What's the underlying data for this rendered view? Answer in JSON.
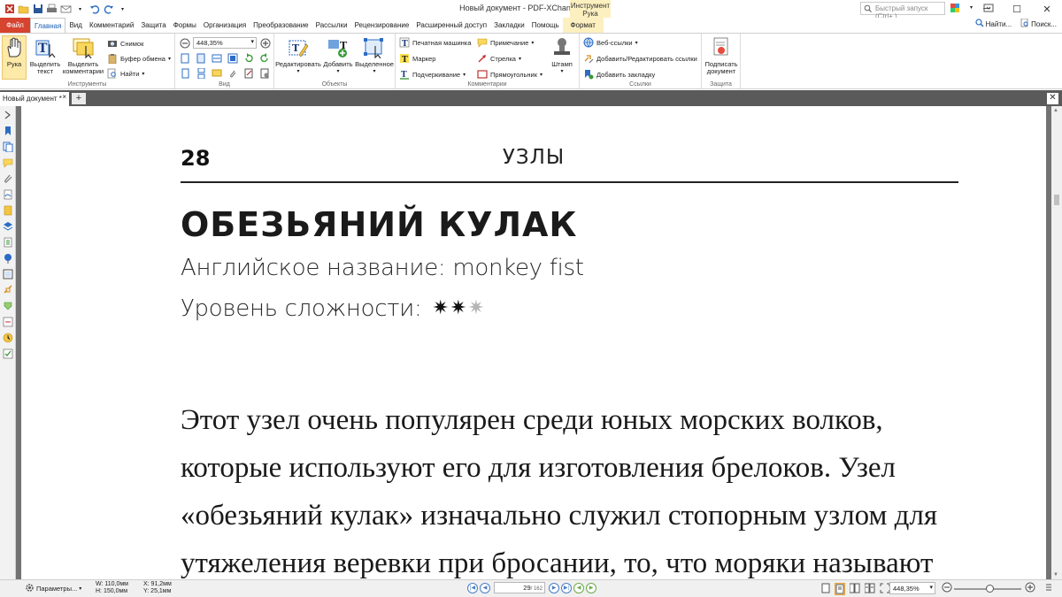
{
  "window": {
    "title": "Новый документ - PDF-XChange Editor",
    "context_group": "Инструмент Рука",
    "quick_launch_placeholder": "Быстрый запуск (Ctrl+.)",
    "find_label": "Найти...",
    "search_label": "Поиск..."
  },
  "tabs": [
    {
      "label": "Файл"
    },
    {
      "label": "Главная"
    },
    {
      "label": "Вид"
    },
    {
      "label": "Комментарий"
    },
    {
      "label": "Защита"
    },
    {
      "label": "Формы"
    },
    {
      "label": "Организация"
    },
    {
      "label": "Преобразование"
    },
    {
      "label": "Рассылки"
    },
    {
      "label": "Рецензирование"
    },
    {
      "label": "Расширенный доступ"
    },
    {
      "label": "Закладки"
    },
    {
      "label": "Помощь"
    },
    {
      "label": "Формат"
    }
  ],
  "ribbon": {
    "tools": {
      "group_label": "Инструменты",
      "hand": "Рука",
      "select_text": "Выделить текст",
      "select_comments": "Выделить комментарии",
      "snapshot": "Снимок",
      "clipboard": "Буфер обмена",
      "find": "Найти"
    },
    "view": {
      "group_label": "Вид",
      "zoom": "448,35%"
    },
    "objects": {
      "group_label": "Объекты",
      "edit": "Редактировать",
      "add": "Добавить",
      "selected": "Выделенное"
    },
    "comments": {
      "group_label": "Комментарии",
      "typewriter": "Печатная машинка",
      "marker": "Маркер",
      "underline": "Подчеркивание",
      "note": "Примечание",
      "arrow": "Стрелка",
      "rectangle": "Прямоугольник",
      "stamp": "Штамп"
    },
    "links": {
      "group_label": "Ссылки",
      "web_links": "Веб-ссылки",
      "add_edit_links": "Добавить/Редактировать ссылки",
      "add_bookmark": "Добавить закладку"
    },
    "protect": {
      "group_label": "Защита",
      "sign": "Подписать документ"
    }
  },
  "doc_tab": {
    "label": "Новый документ *"
  },
  "page": {
    "number": "28",
    "header": "УЗЛЫ",
    "knot_title": "ОБЕЗЬЯНИЙ КУЛАК",
    "english_name": "Английское название: monkey fist",
    "level_label": "Уровень сложности:",
    "difficulty": {
      "filled": 2,
      "total": 3
    },
    "body_lines": [
      "Этот узел очень популярен среди юных морских волков,",
      "которые используют его для изготовления брелоков. Узел",
      "«обезьяний кулак» изначально служил стопорным узлом для",
      "утяжеления веревки при бросании, то, что моряки называют"
    ]
  },
  "status": {
    "params": "Параметры...",
    "w": "W: 110,0мм",
    "h": "H: 150,0мм",
    "x": "X:   91,2мм",
    "y": "Y:   25,1мм",
    "current_page": "29",
    "total_pages": "/ 162",
    "zoom": "448,35%"
  },
  "colors": {
    "file_tab": "#d6432f",
    "accent": "#1a5fb4",
    "context_tab": "#fdf0c0",
    "gutter": "#737373"
  }
}
